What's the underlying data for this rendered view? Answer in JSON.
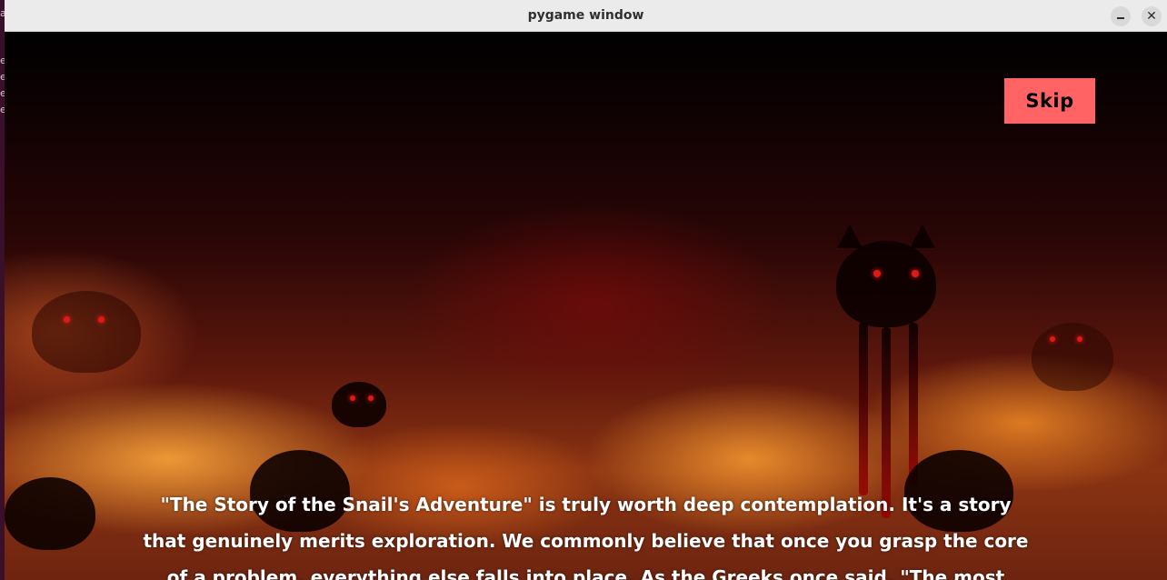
{
  "window": {
    "title": "pygame window",
    "minimize_icon": "minimize-icon",
    "close_icon": "close-icon"
  },
  "desktop": {
    "edge_glyphs": [
      "a",
      "e",
      "e",
      "e",
      "e"
    ]
  },
  "game": {
    "skip_label": "Skip",
    "skip_color": "#ff6363",
    "subtitle_lines": [
      "\"The Story of the Snail's Adventure\" is truly worth deep contemplation. It's a story",
      "that genuinely merits exploration. We commonly believe that once you grasp the core",
      "of a problem, everything else falls into place. As the Greeks once said, \"The most"
    ]
  }
}
